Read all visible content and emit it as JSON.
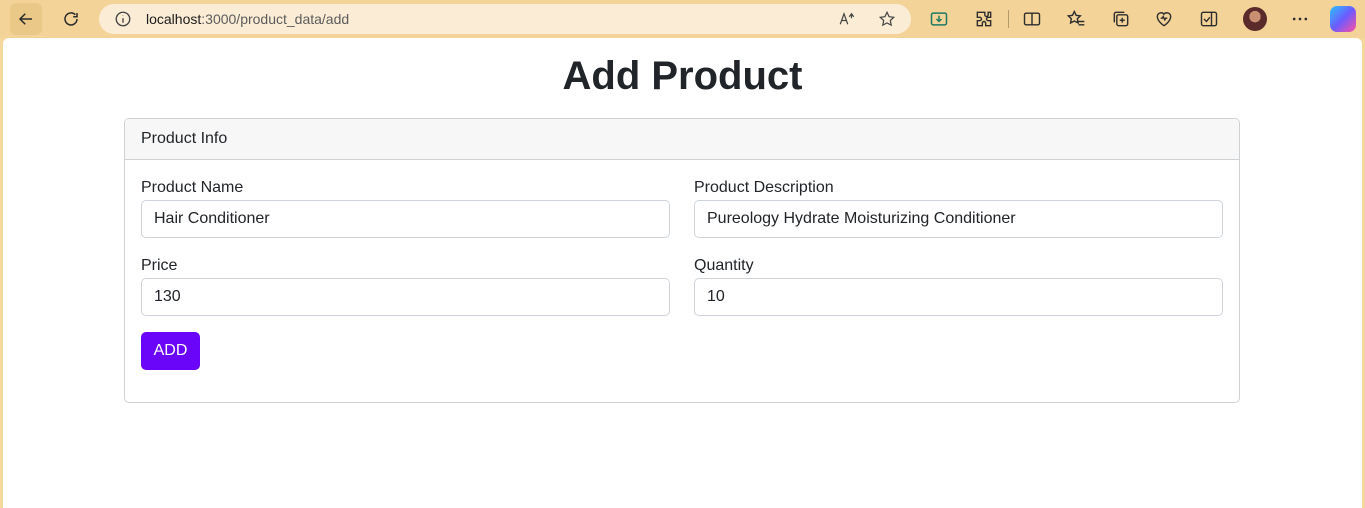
{
  "browser": {
    "url_host": "localhost",
    "url_path": ":3000/product_data/add"
  },
  "page": {
    "title": "Add Product",
    "card_header": "Product Info",
    "fields": {
      "name": {
        "label": "Product Name",
        "value": "Hair Conditioner"
      },
      "description": {
        "label": "Product Description",
        "value": "Pureology Hydrate Moisturizing Conditioner"
      },
      "price": {
        "label": "Price",
        "value": "130"
      },
      "quantity": {
        "label": "Quantity",
        "value": "10"
      }
    },
    "submit_label": "ADD"
  },
  "colors": {
    "accent": "#6a05f9",
    "chrome": "#f3d398"
  }
}
